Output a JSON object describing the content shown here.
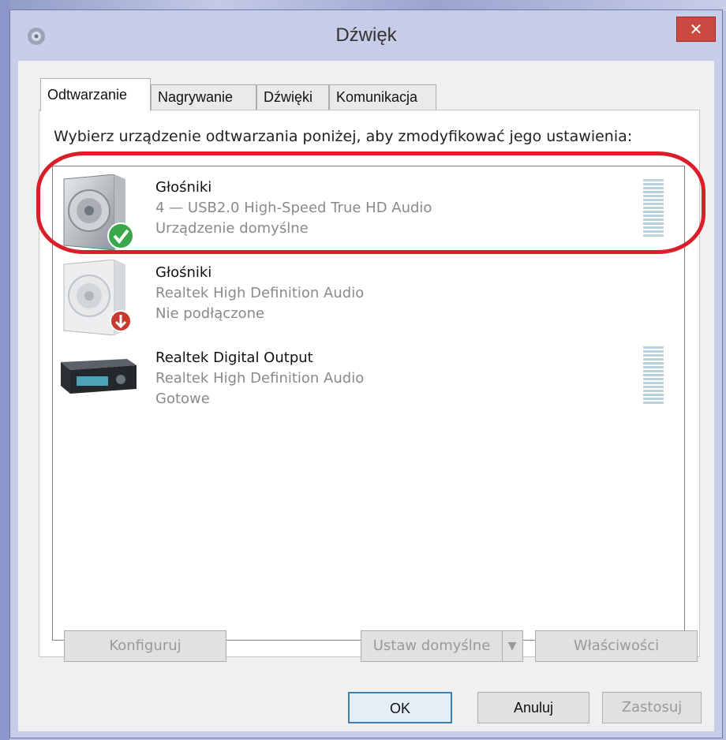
{
  "window": {
    "title": "Dźwięk",
    "close_label": "✕"
  },
  "tabs": [
    {
      "label": "Odtwarzanie",
      "active": true
    },
    {
      "label": "Nagrywanie",
      "active": false
    },
    {
      "label": "Dźwięki",
      "active": false
    },
    {
      "label": "Komunikacja",
      "active": false
    }
  ],
  "instruction": "Wybierz urządzenie odtwarzania poniżej, aby zmodyfikować jego ustawienia:",
  "devices": [
    {
      "name": "Głośniki",
      "line2": "4 — USB2.0 High-Speed True HD Audio",
      "line3": "Urządzenie domyślne",
      "icon": "speaker-default-icon"
    },
    {
      "name": "Głośniki",
      "line2": "Realtek High Definition Audio",
      "line3": "Nie podłączone",
      "icon": "speaker-disconnected-icon"
    },
    {
      "name": "Realtek Digital Output",
      "line2": "Realtek High Definition Audio",
      "line3": "Gotowe",
      "icon": "digital-output-receiver-icon"
    }
  ],
  "buttons": {
    "configure": "Konfiguruj",
    "set_default": "Ustaw domyślne",
    "set_default_arrow": "▼",
    "properties": "Właściwości",
    "ok": "OK",
    "cancel": "Anuluj",
    "apply": "Zastosuj"
  },
  "colors": {
    "highlight": "#d91f2a",
    "close_button": "#c94a40",
    "accent": "#3c7fb1"
  }
}
